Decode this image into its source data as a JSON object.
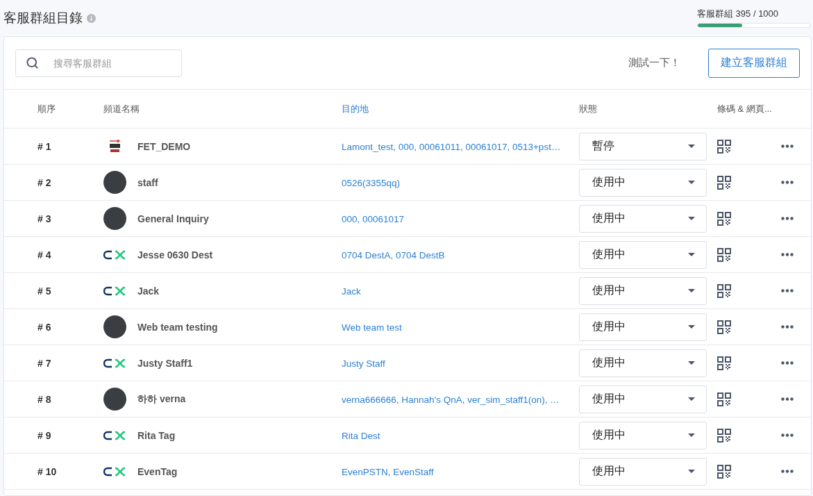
{
  "page": {
    "title": "客服群組目錄"
  },
  "quota": {
    "label": "客服群組 395 / 1000",
    "level": 0.395
  },
  "toolbar": {
    "search": {
      "placeholder": "搜尋客服群組"
    },
    "test_link": "測試一下！",
    "create_button": "建立客服群組"
  },
  "table": {
    "columns": [
      {
        "label": "順序",
        "sorted": false
      },
      {
        "label": "頻道名稱",
        "sorted": false
      },
      {
        "label": "目的地",
        "sorted": true
      },
      {
        "label": "狀態",
        "sorted": false
      },
      {
        "label": "條碼 & 網頁...",
        "sorted": false
      }
    ],
    "rows": [
      {
        "order": "# 1",
        "kind": "fet",
        "name": "FET_DEMO",
        "destinations": "Lamont_test, 000, 00061011, 00061017, 0513+pst…",
        "status": "暫停"
      },
      {
        "order": "# 2",
        "kind": "photo",
        "name": "staff",
        "destinations": "0526(3355qq)",
        "status": "使用中"
      },
      {
        "order": "# 3",
        "kind": "photo",
        "name": "General Inquiry",
        "destinations": "000, 00061017",
        "status": "使用中"
      },
      {
        "order": "# 4",
        "kind": "cx",
        "name": "Jesse 0630 Dest",
        "destinations": "0704 DestA, 0704 DestB",
        "status": "使用中"
      },
      {
        "order": "# 5",
        "kind": "cx",
        "name": "Jack",
        "destinations": "Jack",
        "status": "使用中"
      },
      {
        "order": "# 6",
        "kind": "photo",
        "name": "Web team testing",
        "destinations": "Web team test",
        "status": "使用中"
      },
      {
        "order": "# 7",
        "kind": "cx",
        "name": "Justy Staff1",
        "destinations": "Justy Staff",
        "status": "使用中"
      },
      {
        "order": "# 8",
        "kind": "photo",
        "name": "하하 verna",
        "destinations": "verna666666, Hannah's QnA, ver_sim_staff1(on), …",
        "status": "使用中"
      },
      {
        "order": "# 9",
        "kind": "cx",
        "name": "Rita Tag",
        "destinations": "Rita Dest",
        "status": "使用中"
      },
      {
        "order": "# 10",
        "kind": "cx",
        "name": "EvenTag",
        "destinations": "EvenPSTN, EvenStaff",
        "status": "使用中"
      }
    ]
  }
}
